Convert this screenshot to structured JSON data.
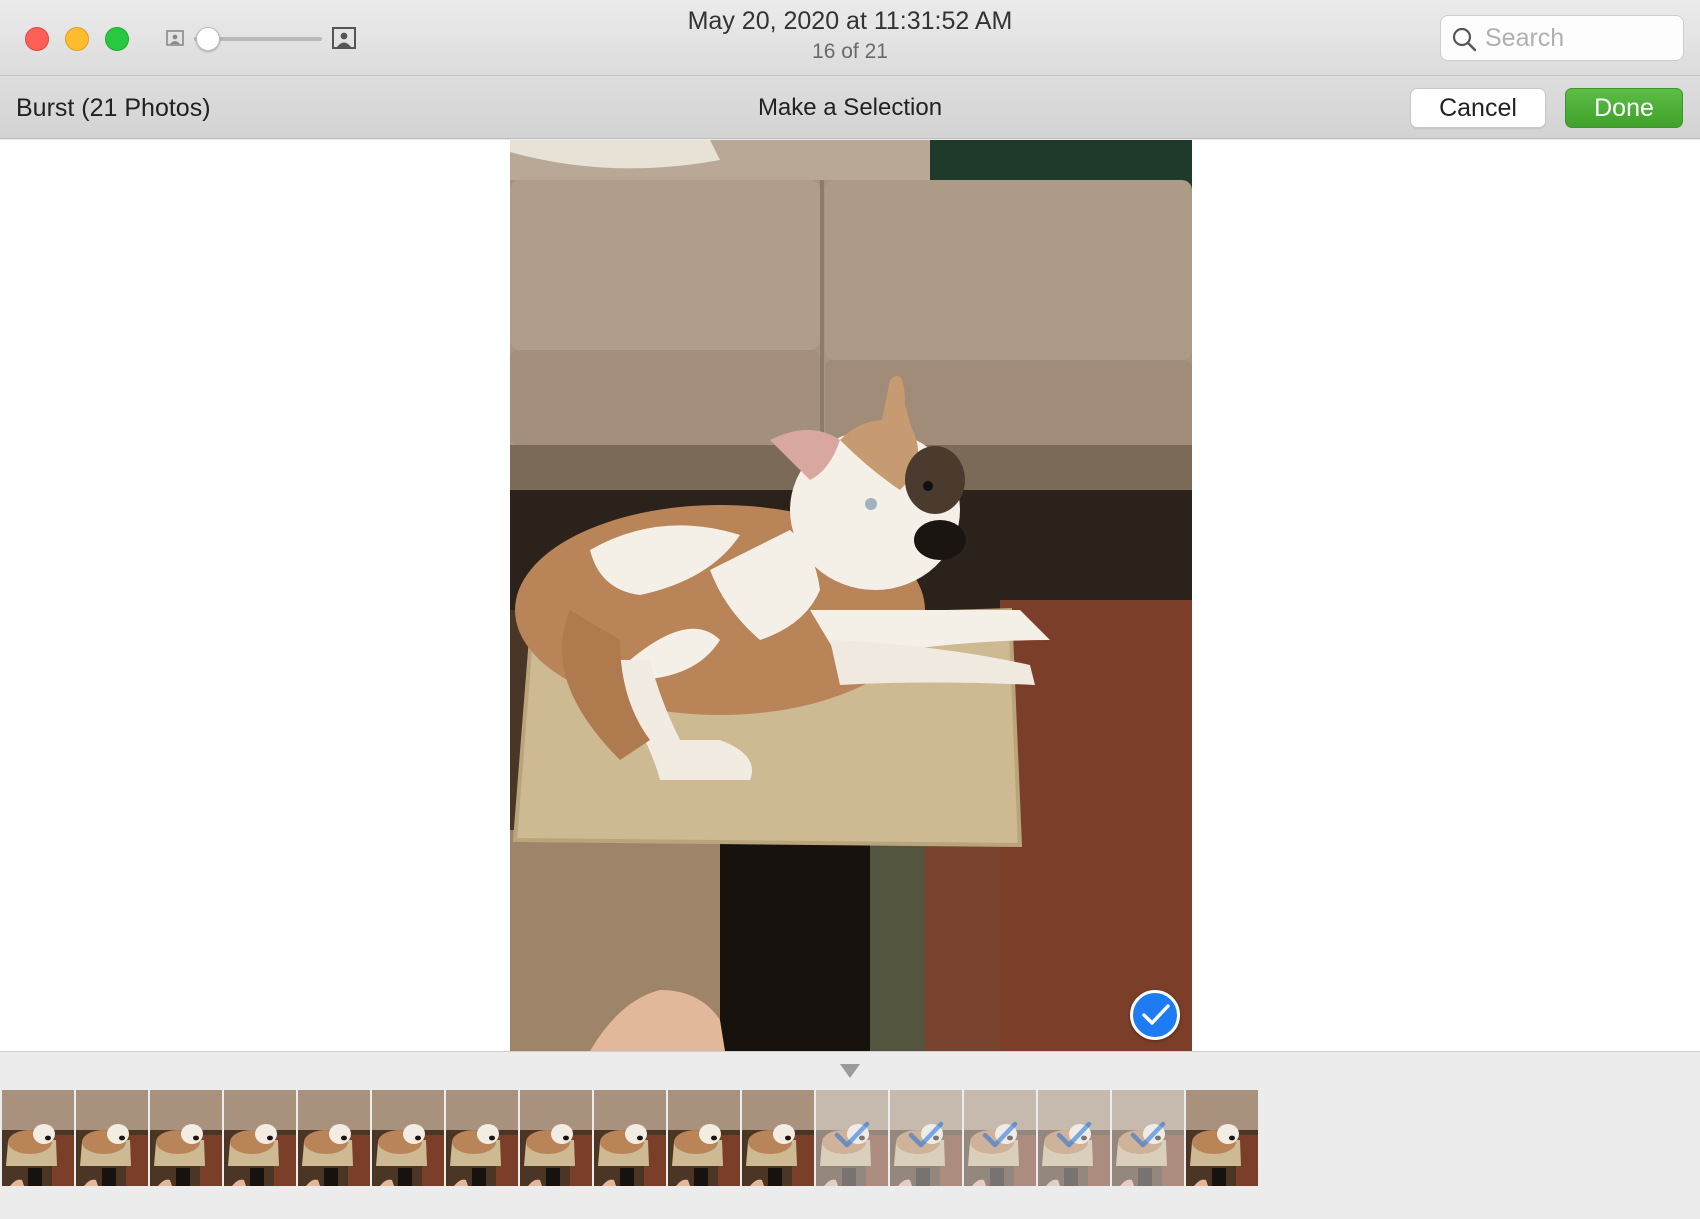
{
  "window": {
    "title": "May 20, 2020 at 11:31:52 AM",
    "subtitle": "16 of 21"
  },
  "search": {
    "placeholder": "Search",
    "value": ""
  },
  "toolbar": {
    "burst_label": "Burst (21 Photos)",
    "title": "Make a Selection",
    "cancel_label": "Cancel",
    "done_label": "Done"
  },
  "viewer": {
    "selected": true
  },
  "filmstrip": {
    "thumbnails": [
      {
        "selected": false
      },
      {
        "selected": false
      },
      {
        "selected": false
      },
      {
        "selected": false
      },
      {
        "selected": false
      },
      {
        "selected": false
      },
      {
        "selected": false
      },
      {
        "selected": false
      },
      {
        "selected": false
      },
      {
        "selected": false
      },
      {
        "selected": false
      },
      {
        "selected": true
      },
      {
        "selected": true
      },
      {
        "selected": true
      },
      {
        "selected": true
      },
      {
        "selected": true
      },
      {
        "selected": false
      }
    ]
  },
  "colors": {
    "accent_blue": "#1e7cf2",
    "done_green": "#4cb036",
    "check_blue": "#1a6fe0"
  },
  "icons": {
    "zoom_small": "small-photo-icon",
    "zoom_large": "large-photo-icon",
    "search": "search-icon",
    "selected": "checkmark-icon",
    "pointer": "triangle-down-icon"
  }
}
